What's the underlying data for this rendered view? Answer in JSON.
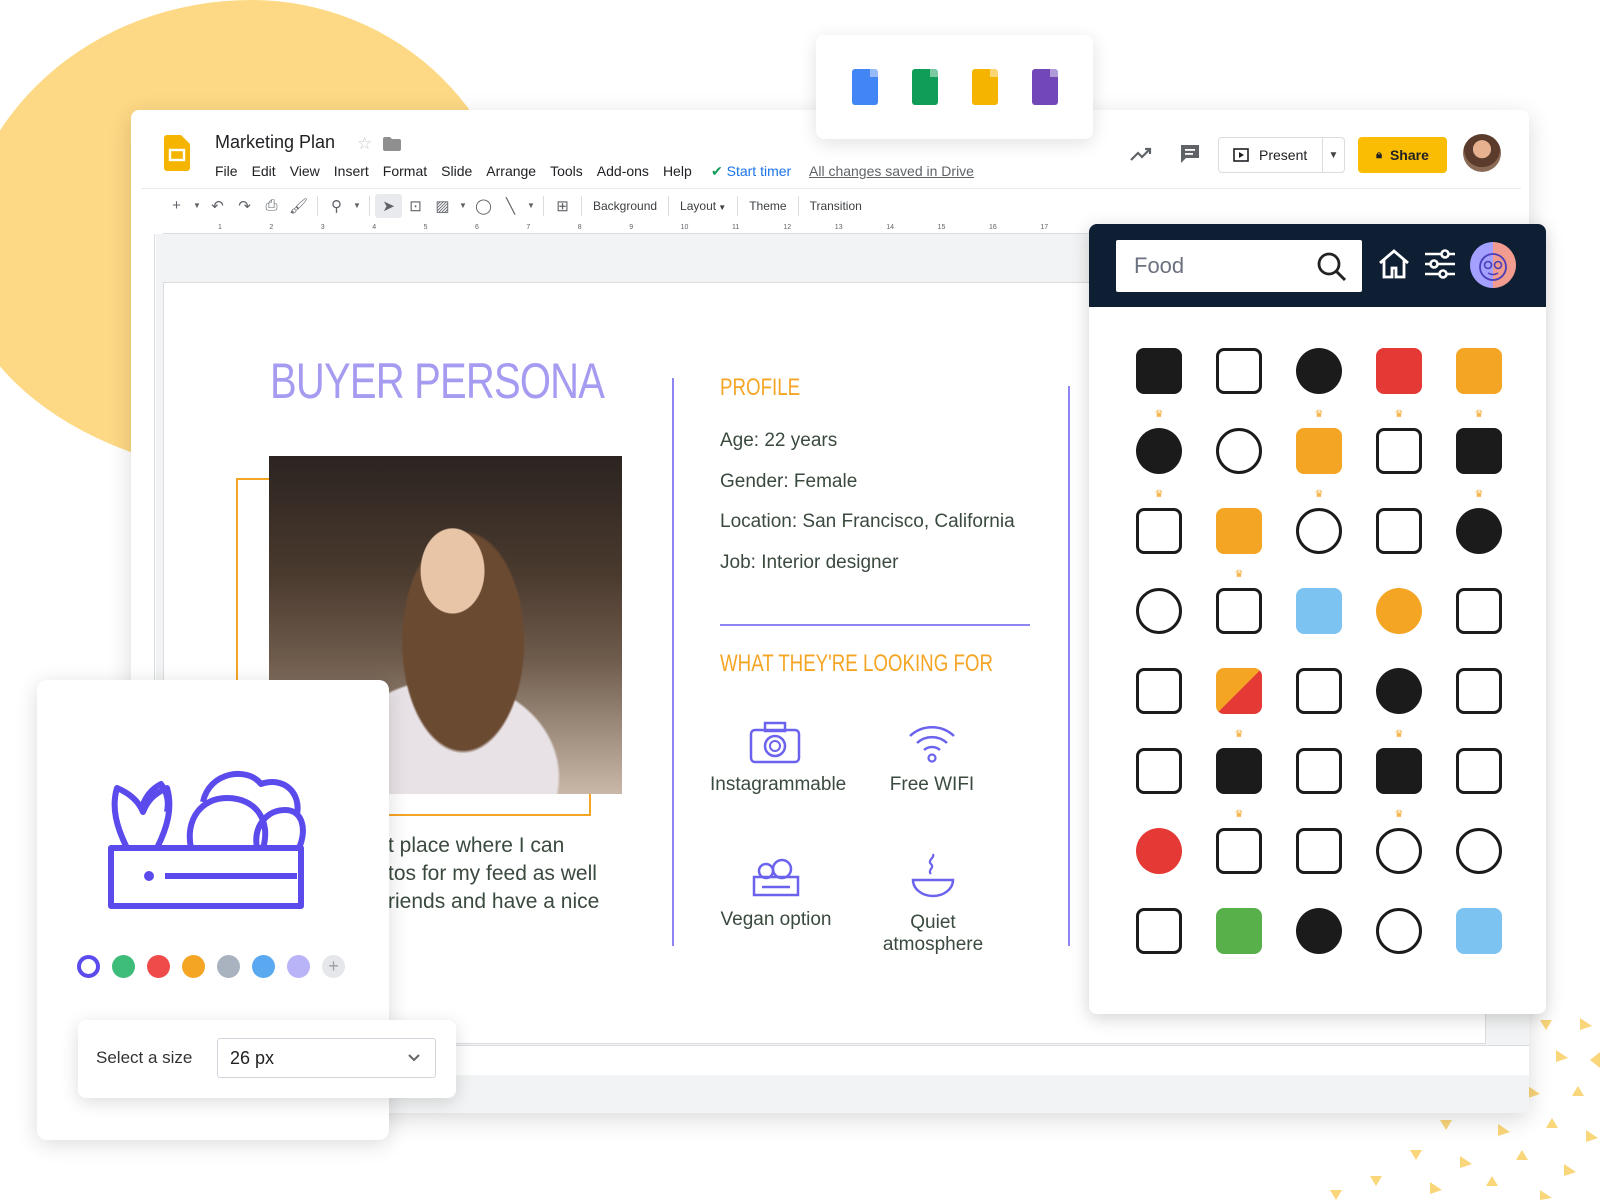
{
  "app": {
    "title": "Marketing Plan",
    "menu": [
      "File",
      "Edit",
      "View",
      "Insert",
      "Format",
      "Slide",
      "Arrange",
      "Tools",
      "Add-ons",
      "Help"
    ],
    "start_timer": "Start timer",
    "saved_status": "All changes saved in Drive",
    "present_label": "Present",
    "share_label": "Share",
    "toolbar_buttons": [
      "Background",
      "Layout",
      "Theme",
      "Transition"
    ],
    "ruler_numbers": [
      "1",
      "2",
      "3",
      "4",
      "5",
      "6",
      "7",
      "8",
      "9",
      "10",
      "11",
      "12",
      "13",
      "14",
      "15",
      "16",
      "17"
    ]
  },
  "slide": {
    "title": "BUYER PERSONA",
    "profile_heading": "PROFILE",
    "profile": {
      "age": "Age: 22 years",
      "gender": "Gender: Female",
      "location": "Location: San Francisco, California",
      "job": "Job: Interior designer"
    },
    "body_text": [
      "t place where I can",
      "tos for my feed as well",
      "riends and have a nice"
    ],
    "looking_heading": "WHAT THEY'RE LOOKING FOR",
    "features": [
      {
        "label": "Instagrammable",
        "icon": "camera-icon"
      },
      {
        "label": "Free WIFI",
        "icon": "wifi-icon"
      },
      {
        "label": "Vegan option",
        "icon": "vegetable-crate-icon"
      },
      {
        "label": "Quiet atmosphere",
        "icon": "bowl-steam-icon"
      }
    ]
  },
  "suite": {
    "apps": [
      {
        "name": "docs-icon",
        "color": "#4285f4"
      },
      {
        "name": "sheets-icon",
        "color": "#0f9d58"
      },
      {
        "name": "slides-icon",
        "color": "#f4b400"
      },
      {
        "name": "forms-icon",
        "color": "#7248b9"
      }
    ]
  },
  "icon_panel": {
    "search_value": "Food",
    "icons": [
      {
        "name": "barrels-icon",
        "premium": true
      },
      {
        "name": "coffee-cup-icon",
        "premium": false
      },
      {
        "name": "pizza-slice-icon",
        "premium": true
      },
      {
        "name": "delivery-scooter-icon",
        "premium": true
      },
      {
        "name": "delivery-rider-icon",
        "premium": true
      },
      {
        "name": "barrel-icon",
        "premium": true
      },
      {
        "name": "serving-tray-icon",
        "premium": false
      },
      {
        "name": "honey-bottle-icon",
        "premium": true
      },
      {
        "name": "cocktail-icon",
        "premium": false
      },
      {
        "name": "noodle-bowl-icon",
        "premium": true
      },
      {
        "name": "bread-icon",
        "premium": false
      },
      {
        "name": "pattern-tile-icon",
        "premium": true
      },
      {
        "name": "steak-icon",
        "premium": false
      },
      {
        "name": "plate-cutlery-icon",
        "premium": false
      },
      {
        "name": "apple-icon",
        "premium": false
      },
      {
        "name": "salad-bowl-icon",
        "premium": false
      },
      {
        "name": "birthday-cake-icon",
        "premium": false
      },
      {
        "name": "utensils-icon",
        "premium": false
      },
      {
        "name": "burger-icon",
        "premium": false
      },
      {
        "name": "bottles-icon",
        "premium": false
      },
      {
        "name": "food-truck-icon",
        "premium": false
      },
      {
        "name": "pizza-icon",
        "premium": true
      },
      {
        "name": "thumbs-up-rating-icon",
        "premium": false
      },
      {
        "name": "rolling-pin-icon",
        "premium": true
      },
      {
        "name": "takeaway-cup-icon",
        "premium": false
      },
      {
        "name": "vegetable-crate-icon",
        "premium": false
      },
      {
        "name": "layered-cake-icon",
        "premium": true
      },
      {
        "name": "delivery-bike-icon",
        "premium": false
      },
      {
        "name": "chef-icon",
        "premium": true
      },
      {
        "name": "pizza-outline-icon",
        "premium": false
      },
      {
        "name": "tomato-icon",
        "premium": false
      },
      {
        "name": "menu-book-icon",
        "premium": false
      },
      {
        "name": "recipe-clipboard-icon",
        "premium": false
      },
      {
        "name": "hamburger-icon",
        "premium": false
      },
      {
        "name": "burger-outline-icon",
        "premium": false
      },
      {
        "name": "cheers-glasses-icon",
        "premium": false
      },
      {
        "name": "grocery-basket-icon",
        "premium": false
      },
      {
        "name": "dinner-plate-icon",
        "premium": false
      },
      {
        "name": "apple-outline-icon",
        "premium": false
      },
      {
        "name": "water-bottle-icon",
        "premium": false
      }
    ]
  },
  "color_card": {
    "preview_icon": "vegetable-crate-icon",
    "colors": [
      "#5b4bec",
      "#3ebd7a",
      "#f04b4b",
      "#f5a524",
      "#a8b3bf",
      "#5aa9f0",
      "#b9b3f7"
    ],
    "selected_color": "#5b4bec"
  },
  "size_card": {
    "label": "Select a size",
    "value": "26 px"
  }
}
